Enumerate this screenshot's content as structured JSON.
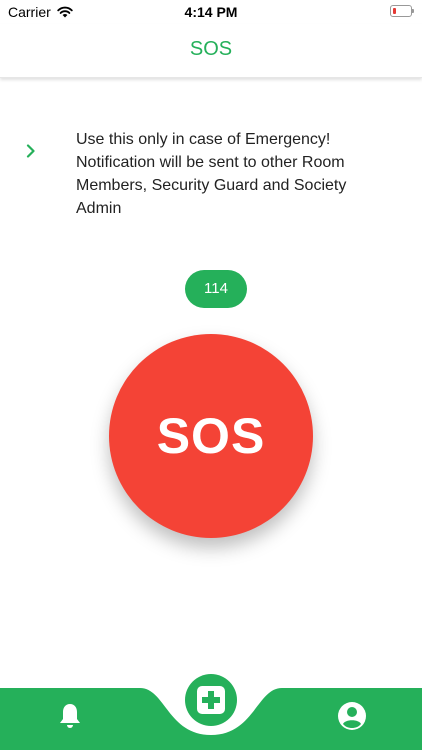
{
  "status_bar": {
    "carrier": "Carrier",
    "time": "4:14 PM"
  },
  "header": {
    "title": "SOS"
  },
  "info": {
    "message": "Use this only in case of Emergency! Notification will be sent to other Room Members, Security Guard and Society Admin"
  },
  "emergency_number": "114",
  "sos_button": {
    "label": "SOS"
  },
  "bottom_nav": {
    "items": [
      {
        "id": "notifications",
        "icon": "bell-icon"
      },
      {
        "id": "emergency",
        "icon": "medical-plus-icon"
      },
      {
        "id": "profile",
        "icon": "user-circle-icon"
      }
    ]
  },
  "colors": {
    "accent_green": "#25b05a",
    "sos_red": "#f44336",
    "battery_low": "#e53935"
  }
}
